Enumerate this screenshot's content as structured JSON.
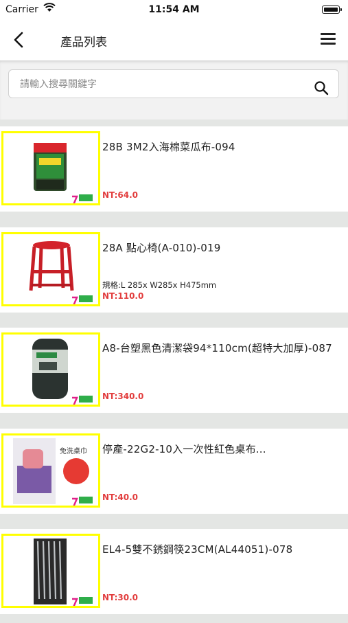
{
  "status_bar": {
    "carrier": "Carrier",
    "time": "11:54 AM"
  },
  "nav": {
    "title": "產品列表"
  },
  "search": {
    "placeholder": "請輸入搜尋關鍵字"
  },
  "products": [
    {
      "name": "28B 3M2入海棉菜瓜布-094",
      "spec": "",
      "price": "NT:64.0"
    },
    {
      "name": "28A 點心椅(A-010)-019",
      "spec": "規格:L 285x W285x H475mm",
      "price": "NT:110.0"
    },
    {
      "name": "A8-台塑黑色清潔袋94*110cm(超特大加厚)-087",
      "spec": "",
      "price": "NT:340.0"
    },
    {
      "name": "停產-22G2-10入一次性紅色桌布...",
      "spec": "",
      "price": "NT:40.0"
    },
    {
      "name": "EL4-5雙不銹鋼筷23CM(AL44051)-078",
      "spec": "",
      "price": "NT:30.0"
    }
  ],
  "thumb_labels": {
    "tablecloth_tag": "免洗桌巾"
  },
  "colors": {
    "thumb_border": "#ffff00",
    "price": "#e23d3d",
    "list_bg": "#e4e6e4"
  }
}
